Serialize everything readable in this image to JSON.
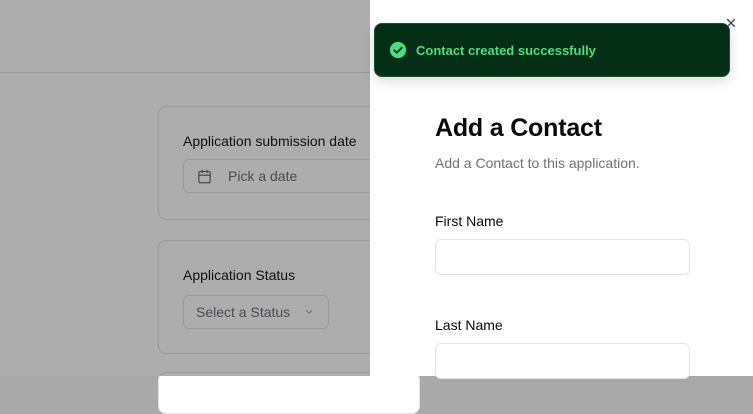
{
  "background": {
    "date_card": {
      "label": "Application submission date",
      "date_placeholder": "Pick a date"
    },
    "status_card": {
      "label": "Application Status",
      "select_placeholder": "Select a Status"
    }
  },
  "sheet": {
    "title": "Add a Contact",
    "description": "Add a Contact to this application.",
    "fields": {
      "first_name": {
        "label": "First Name",
        "value": "",
        "placeholder": ""
      },
      "last_name": {
        "label": "Last Name",
        "value": "",
        "placeholder": ""
      }
    },
    "close_icon": "close-icon"
  },
  "toast": {
    "message": "Contact created successfully",
    "icon": "check-circle-icon",
    "colors": {
      "background": "#052e16",
      "text": "#4ade80",
      "icon": "#4ade80"
    }
  },
  "colors": {
    "overlay": "rgba(0,0,0,0.32)",
    "muted_text": "#71717a",
    "border": "#e4e4e7"
  }
}
